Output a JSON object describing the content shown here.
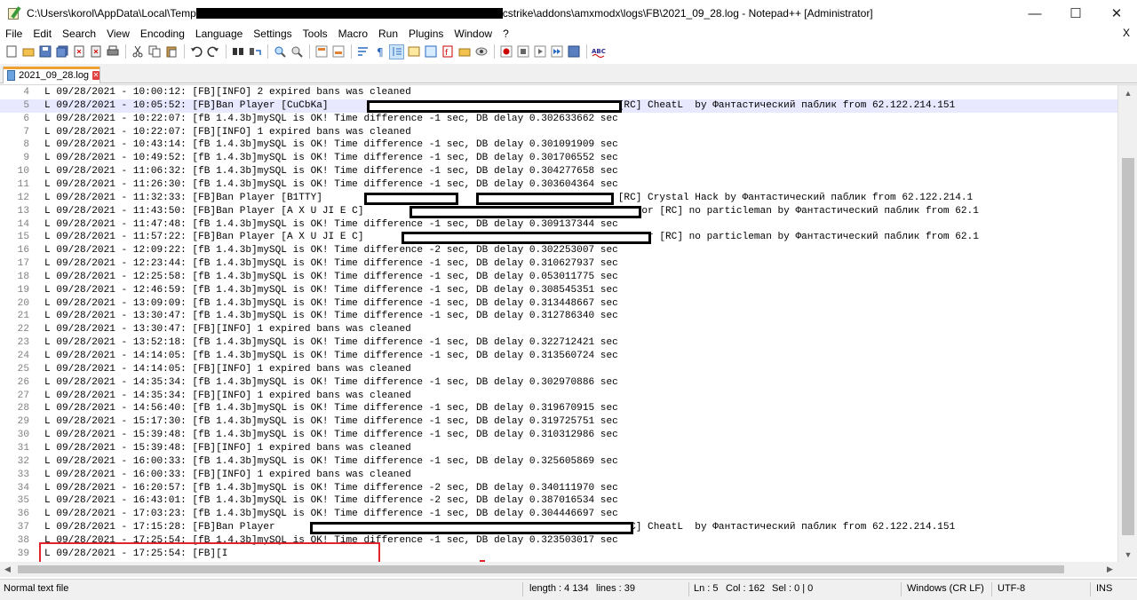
{
  "window": {
    "title_prefix": "C:\\Users\\korol\\AppData\\Local\\Temp",
    "title_suffix": "cstrike\\addons\\amxmodx\\logs\\FB\\2021_09_28.log - Notepad++ [Administrator]",
    "minimize": "—",
    "maximize": "☐",
    "close": "✕"
  },
  "menu": {
    "items": [
      "File",
      "Edit",
      "Search",
      "View",
      "Encoding",
      "Language",
      "Settings",
      "Tools",
      "Macro",
      "Run",
      "Plugins",
      "Window",
      "?"
    ],
    "close_doc": "X"
  },
  "toolbar": {
    "icons": [
      "new-icon",
      "open-icon",
      "save-icon",
      "save-all-icon",
      "close-icon",
      "close-all-icon",
      "print-icon",
      "cut-icon",
      "copy-icon",
      "paste-icon",
      "undo-icon",
      "redo-icon",
      "find-icon",
      "replace-icon",
      "zoom-in-icon",
      "zoom-out-icon",
      "sync-v-icon",
      "sync-h-icon",
      "wrap-icon",
      "all-chars-icon",
      "indent-guide-icon",
      "lang-icon",
      "doc-map-icon",
      "func-list-icon",
      "folder-icon",
      "monitor-icon",
      "record-icon",
      "stop-icon",
      "play-icon",
      "play-multi-icon",
      "save-macro-icon",
      "spellcheck-icon"
    ]
  },
  "tab": {
    "label": "2021_09_28.log",
    "close": "✕"
  },
  "editor": {
    "current_line_index": 1,
    "lines": [
      {
        "n": "4",
        "text": "L 09/28/2021 - 10:00:12: [FB][INFO] 2 expired bans was cleaned"
      },
      {
        "n": "5",
        "text": "L 09/28/2021 - 10:05:52: [FB]Ban Player [CuCbKa]                                 on 1 неделя for [RC] CheatL  by Фантастический паблик from 62.122.214.151"
      },
      {
        "n": "6",
        "text": "L 09/28/2021 - 10:22:07: [fB 1.4.3b]mySQL is OK! Time difference -1 sec, DB delay 0.302633662 sec"
      },
      {
        "n": "7",
        "text": "L 09/28/2021 - 10:22:07: [FB][INFO] 1 expired bans was cleaned"
      },
      {
        "n": "8",
        "text": "L 09/28/2021 - 10:43:14: [fB 1.4.3b]mySQL is OK! Time difference -1 sec, DB delay 0.301091909 sec"
      },
      {
        "n": "9",
        "text": "L 09/28/2021 - 10:49:52: [fB 1.4.3b]mySQL is OK! Time difference -1 sec, DB delay 0.301706552 sec"
      },
      {
        "n": "10",
        "text": "L 09/28/2021 - 11:06:32: [fB 1.4.3b]mySQL is OK! Time difference -1 sec, DB delay 0.304277658 sec"
      },
      {
        "n": "11",
        "text": "L 09/28/2021 - 11:26:30: [fB 1.4.3b]mySQL is OK! Time difference -1 sec, DB delay 0.303604364 sec"
      },
      {
        "n": "12",
        "text": "L 09/28/2021 - 11:32:33: [FB]Ban Player [B1TTY]                                  on 1 неделя for [RC] Crystal Hack by Фантастический паблик from 62.122.214.1"
      },
      {
        "n": "13",
        "text": "L 09/28/2021 - 11:43:50: [FB]Ban Player [A X U JI E C]                                  on 1 неделя for [RC] no particleman by Фантастический паблик from 62.1"
      },
      {
        "n": "14",
        "text": "L 09/28/2021 - 11:47:48: [fB 1.4.3b]mySQL is OK! Time difference -1 sec, DB delay 0.309137344 sec"
      },
      {
        "n": "15",
        "text": "L 09/28/2021 - 11:57:22: [FB]Ban Player [A X U JI E C]                                  on 1 неделя for [RC] no particleman by Фантастический паблик from 62.1"
      },
      {
        "n": "16",
        "text": "L 09/28/2021 - 12:09:22: [fB 1.4.3b]mySQL is OK! Time difference -2 sec, DB delay 0.302253007 sec"
      },
      {
        "n": "17",
        "text": "L 09/28/2021 - 12:23:44: [fB 1.4.3b]mySQL is OK! Time difference -1 sec, DB delay 0.310627937 sec"
      },
      {
        "n": "18",
        "text": "L 09/28/2021 - 12:25:58: [fB 1.4.3b]mySQL is OK! Time difference -1 sec, DB delay 0.053011775 sec"
      },
      {
        "n": "19",
        "text": "L 09/28/2021 - 12:46:59: [fB 1.4.3b]mySQL is OK! Time difference -1 sec, DB delay 0.308545351 sec"
      },
      {
        "n": "20",
        "text": "L 09/28/2021 - 13:09:09: [fB 1.4.3b]mySQL is OK! Time difference -1 sec, DB delay 0.313448667 sec"
      },
      {
        "n": "21",
        "text": "L 09/28/2021 - 13:30:47: [fB 1.4.3b]mySQL is OK! Time difference -1 sec, DB delay 0.312786340 sec"
      },
      {
        "n": "22",
        "text": "L 09/28/2021 - 13:30:47: [FB][INFO] 1 expired bans was cleaned"
      },
      {
        "n": "23",
        "text": "L 09/28/2021 - 13:52:18: [fB 1.4.3b]mySQL is OK! Time difference -1 sec, DB delay 0.322712421 sec"
      },
      {
        "n": "24",
        "text": "L 09/28/2021 - 14:14:05: [fB 1.4.3b]mySQL is OK! Time difference -1 sec, DB delay 0.313560724 sec"
      },
      {
        "n": "25",
        "text": "L 09/28/2021 - 14:14:05: [FB][INFO] 1 expired bans was cleaned"
      },
      {
        "n": "26",
        "text": "L 09/28/2021 - 14:35:34: [fB 1.4.3b]mySQL is OK! Time difference -1 sec, DB delay 0.302970886 sec"
      },
      {
        "n": "27",
        "text": "L 09/28/2021 - 14:35:34: [FB][INFO] 1 expired bans was cleaned"
      },
      {
        "n": "28",
        "text": "L 09/28/2021 - 14:56:40: [fB 1.4.3b]mySQL is OK! Time difference -1 sec, DB delay 0.319670915 sec"
      },
      {
        "n": "29",
        "text": "L 09/28/2021 - 15:17:30: [fB 1.4.3b]mySQL is OK! Time difference -1 sec, DB delay 0.319725751 sec"
      },
      {
        "n": "30",
        "text": "L 09/28/2021 - 15:39:48: [fB 1.4.3b]mySQL is OK! Time difference -1 sec, DB delay 0.310312986 sec"
      },
      {
        "n": "31",
        "text": "L 09/28/2021 - 15:39:48: [FB][INFO] 1 expired bans was cleaned"
      },
      {
        "n": "32",
        "text": "L 09/28/2021 - 16:00:33: [fB 1.4.3b]mySQL is OK! Time difference -1 sec, DB delay 0.325605869 sec"
      },
      {
        "n": "33",
        "text": "L 09/28/2021 - 16:00:33: [FB][INFO] 1 expired bans was cleaned"
      },
      {
        "n": "34",
        "text": "L 09/28/2021 - 16:20:57: [fB 1.4.3b]mySQL is OK! Time difference -2 sec, DB delay 0.340111970 sec"
      },
      {
        "n": "35",
        "text": "L 09/28/2021 - 16:43:01: [fB 1.4.3b]mySQL is OK! Time difference -2 sec, DB delay 0.387016534 sec"
      },
      {
        "n": "36",
        "text": "L 09/28/2021 - 17:03:23: [fB 1.4.3b]mySQL is OK! Time difference -1 sec, DB delay 0.304446697 sec"
      },
      {
        "n": "37",
        "text": "L 09/28/2021 - 17:15:28: [FB]Ban Player                                          on 1 неделя for [RC] CheatL  by Фантастический паблик from 62.122.214.151"
      },
      {
        "n": "38",
        "text": "L 09/28/2021 - 17:25:54: [fB 1.4.3b]mySQL is OK! Time difference -1 sec, DB delay 0.323503017 sec"
      },
      {
        "n": "39",
        "text": "L 09/28/2021 - 17:25:54: [FB][I"
      }
    ]
  },
  "status": {
    "file_type": "Normal text file",
    "length": "length : 4 134",
    "lines": "lines : 39",
    "ln": "Ln : 5",
    "col": "Col : 162",
    "sel": "Sel : 0 | 0",
    "eol": "Windows (CR LF)",
    "encoding": "UTF-8",
    "mode": "INS"
  }
}
